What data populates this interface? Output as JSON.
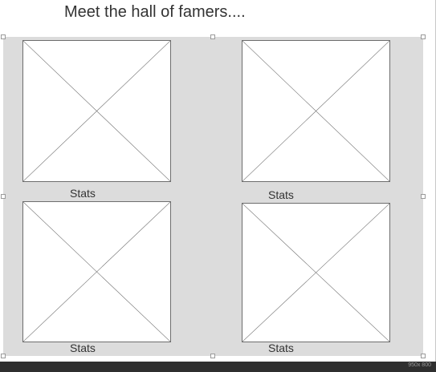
{
  "title": "Meet the hall of famers....",
  "cards": [
    {
      "label": "Stats"
    },
    {
      "label": "Stats"
    },
    {
      "label": "Stats"
    },
    {
      "label": "Stats"
    }
  ],
  "statusbar": {
    "canvas_size": "950x 800"
  },
  "colors": {
    "panel": "#dcdcdc",
    "placeholder_border": "#6d6d6d",
    "statusbar": "#2f2f2f"
  }
}
